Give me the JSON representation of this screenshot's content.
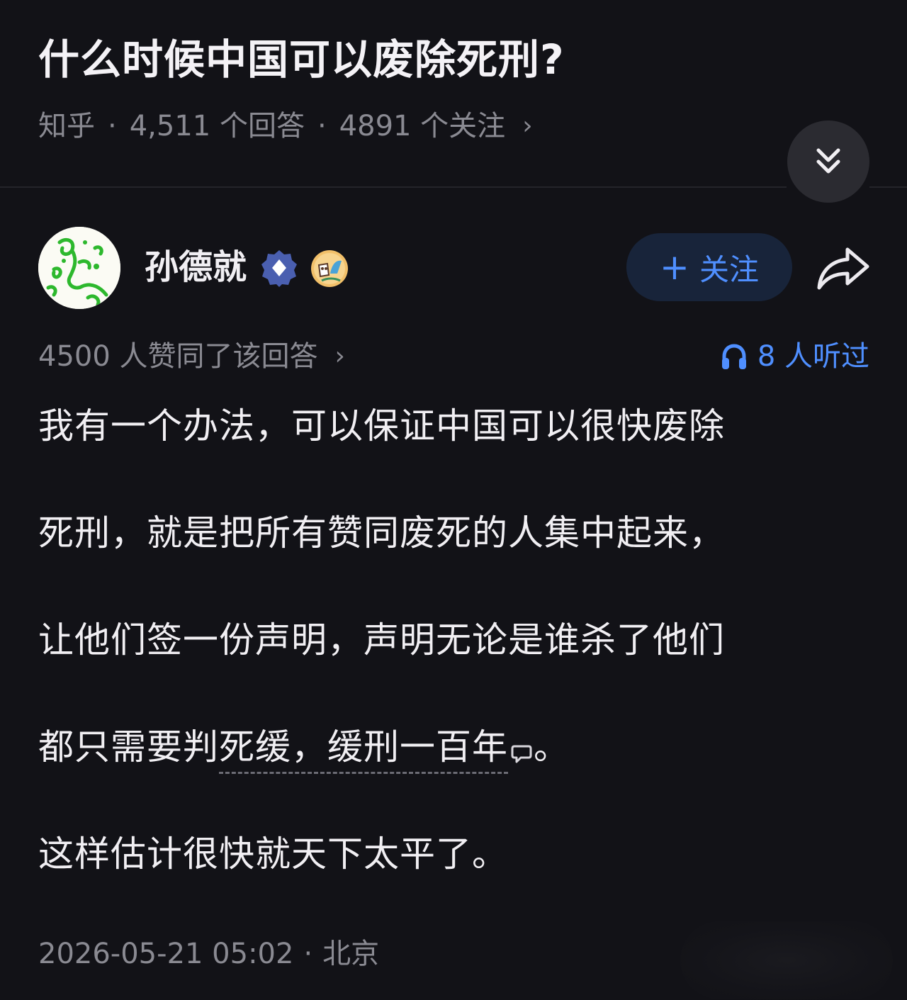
{
  "question": {
    "title": "什么时候中国可以废除死刑?",
    "source": "知乎",
    "answers": "4,511 个回答",
    "follows": "4891 个关注",
    "chevron": "›"
  },
  "author": {
    "name": "孙德就",
    "follow_label": "关注",
    "follow_plus": "+"
  },
  "stats": {
    "votes": "4500 人赞同了该回答",
    "chevron": "›",
    "listened": "8 人听过"
  },
  "content": {
    "p1": "我有一个办法，可以保证中国可以很快废除",
    "p2": "死刑，就是把所有赞同废死的人集中起来，",
    "p3": "让他们签一份声明，声明无论是谁杀了他们",
    "p4_prefix": "都只需要判",
    "p4_annotated": "死缓，缓刑一百年",
    "p4_suffix": "。",
    "p5": "这样估计很快就天下太平了。"
  },
  "footer": {
    "date": "2026-05-21 05:02",
    "separator": "·",
    "location": "北京"
  },
  "colors": {
    "background": "#121217",
    "accent": "#4f8fff",
    "muted": "#8a8a92",
    "follow_bg": "#18243a"
  },
  "icons": {
    "collapse": "double-chevron-down-icon",
    "share": "share-arrow-icon",
    "listen": "headphones-icon",
    "comment": "comment-bubble-icon",
    "verify": "verified-badge-icon"
  }
}
